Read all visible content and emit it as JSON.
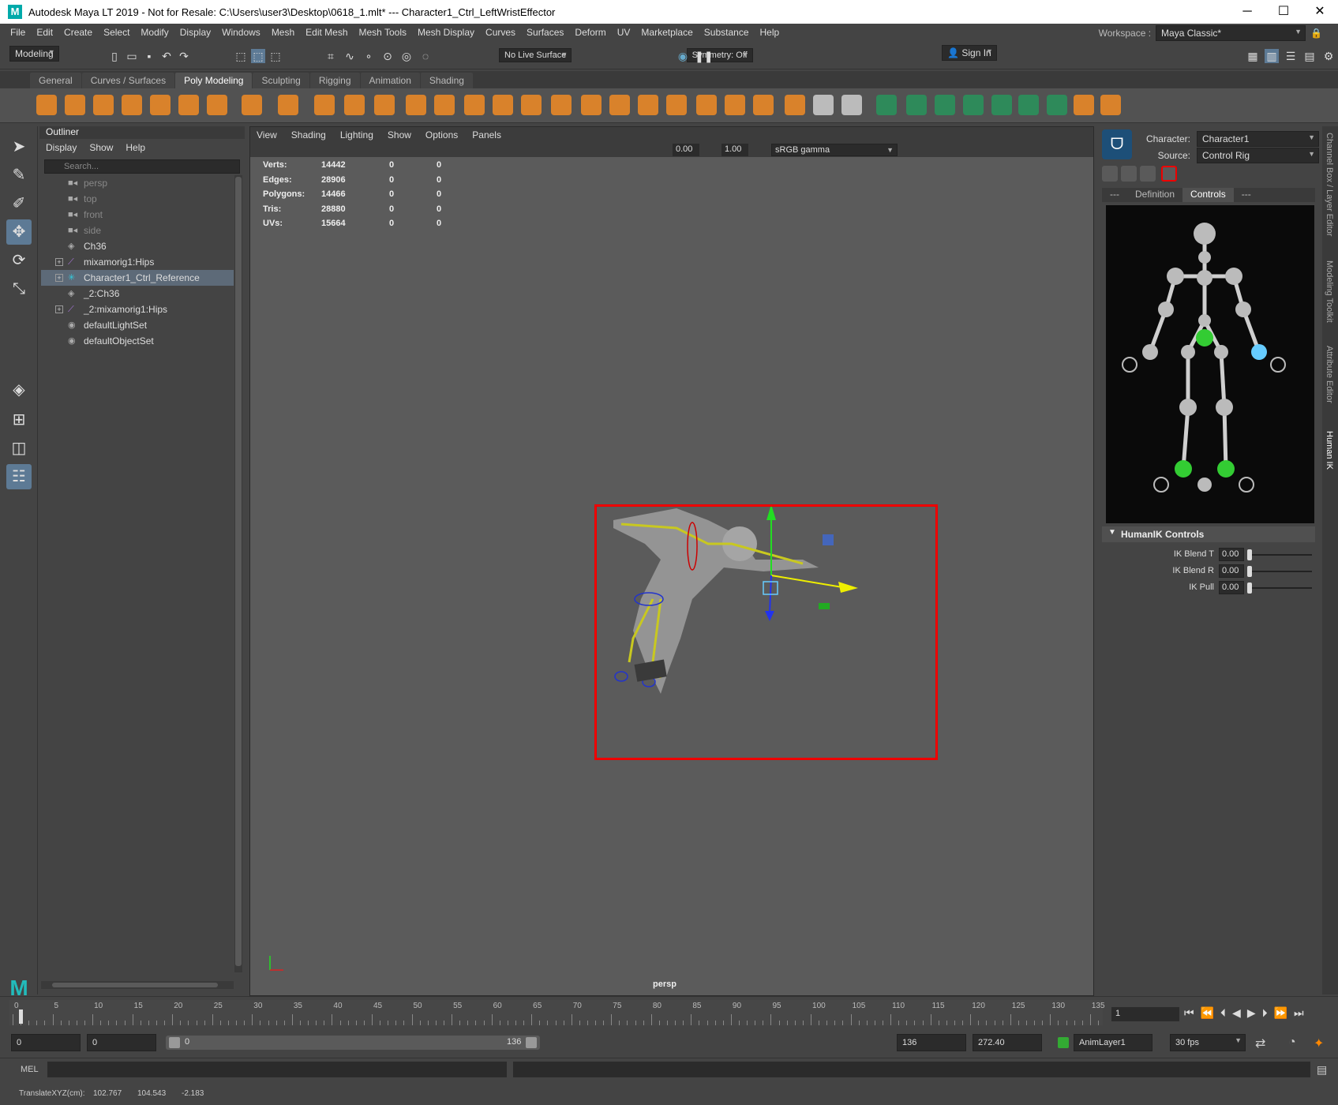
{
  "window": {
    "title": "Autodesk Maya LT 2019 - Not for Resale: C:\\Users\\user3\\Desktop\\0618_1.mlt*   ---   Character1_Ctrl_LeftWristEffector",
    "logo": "M",
    "minimize": "─",
    "maximize": "☐",
    "close": "✕"
  },
  "menu": [
    "File",
    "Edit",
    "Create",
    "Select",
    "Modify",
    "Display",
    "Windows",
    "Mesh",
    "Edit Mesh",
    "Mesh Tools",
    "Mesh Display",
    "Curves",
    "Surfaces",
    "Deform",
    "UV",
    "Marketplace",
    "Substance",
    "Help"
  ],
  "workspace": {
    "label": "Workspace :",
    "value": "Maya Classic*"
  },
  "status": {
    "mode": "Modeling",
    "live_surface": "No Live Surface",
    "symmetry": "Symmetry: Off",
    "sign_in": "Sign In"
  },
  "shelf_tabs": [
    "General",
    "Curves / Surfaces",
    "Poly Modeling",
    "Sculpting",
    "Rigging",
    "Animation",
    "Shading"
  ],
  "shelf_active": "Poly Modeling",
  "outliner": {
    "title": "Outliner",
    "menu": [
      "Display",
      "Show",
      "Help"
    ],
    "search_placeholder": "Search...",
    "items": [
      {
        "label": "persp",
        "icon": "camera-icon",
        "dim": true
      },
      {
        "label": "top",
        "icon": "camera-icon",
        "dim": true
      },
      {
        "label": "front",
        "icon": "camera-icon",
        "dim": true
      },
      {
        "label": "side",
        "icon": "camera-icon",
        "dim": true
      },
      {
        "label": "Ch36",
        "icon": "mesh-icon"
      },
      {
        "label": "mixamorig1:Hips",
        "icon": "joint-icon",
        "expand": "+"
      },
      {
        "label": "Character1_Ctrl_Reference",
        "icon": "hik-icon",
        "expand": "+",
        "selected": true
      },
      {
        "label": "_2:Ch36",
        "icon": "mesh-icon"
      },
      {
        "label": "_2:mixamorig1:Hips",
        "icon": "joint-icon",
        "expand": "+"
      },
      {
        "label": "defaultLightSet",
        "icon": "set-icon"
      },
      {
        "label": "defaultObjectSet",
        "icon": "set-icon"
      }
    ]
  },
  "viewport": {
    "menu": [
      "View",
      "Shading",
      "Lighting",
      "Show",
      "Options",
      "Panels"
    ],
    "near": "0.00",
    "far": "1.00",
    "color_space": "sRGB gamma",
    "hud": [
      {
        "label": "Verts:",
        "a": "14442",
        "b": "0",
        "c": "0"
      },
      {
        "label": "Edges:",
        "a": "28906",
        "b": "0",
        "c": "0"
      },
      {
        "label": "Polygons:",
        "a": "14466",
        "b": "0",
        "c": "0"
      },
      {
        "label": "Tris:",
        "a": "28880",
        "b": "0",
        "c": "0"
      },
      {
        "label": "UVs:",
        "a": "15664",
        "b": "0",
        "c": "0"
      }
    ],
    "camera": "persp"
  },
  "hik": {
    "character_label": "Character:",
    "character": "Character1",
    "source_label": "Source:",
    "source": "Control Rig",
    "tabs": [
      "---",
      "Definition",
      "Controls",
      "---"
    ],
    "active_tab": "Controls",
    "controls_title": "HumanIK Controls",
    "ik": [
      {
        "label": "IK Blend T",
        "value": "0.00"
      },
      {
        "label": "IK Blend R",
        "value": "0.00"
      },
      {
        "label": "IK Pull",
        "value": "0.00"
      }
    ]
  },
  "side_tabs": [
    "Channel Box / Layer Editor",
    "Modeling Toolkit",
    "Attribute Editor",
    "Human IK"
  ],
  "timeline": {
    "ticks": [
      "0",
      "5",
      "10",
      "15",
      "20",
      "25",
      "30",
      "35",
      "40",
      "45",
      "50",
      "55",
      "60",
      "65",
      "70",
      "75",
      "80",
      "85",
      "90",
      "95",
      "100",
      "105",
      "110",
      "115",
      "120",
      "125",
      "130",
      "135"
    ],
    "current": "1"
  },
  "range": {
    "start": "0",
    "playback_start": "0",
    "slider_start": "0",
    "slider_end": "136",
    "playback_end": "136",
    "end": "272.40",
    "anim_layer": "AnimLayer1",
    "fps": "30 fps"
  },
  "cmd": {
    "label": "MEL"
  },
  "help": {
    "label": "TranslateXYZ(cm):",
    "x": "102.767",
    "y": "104.543",
    "z": "-2.183"
  }
}
